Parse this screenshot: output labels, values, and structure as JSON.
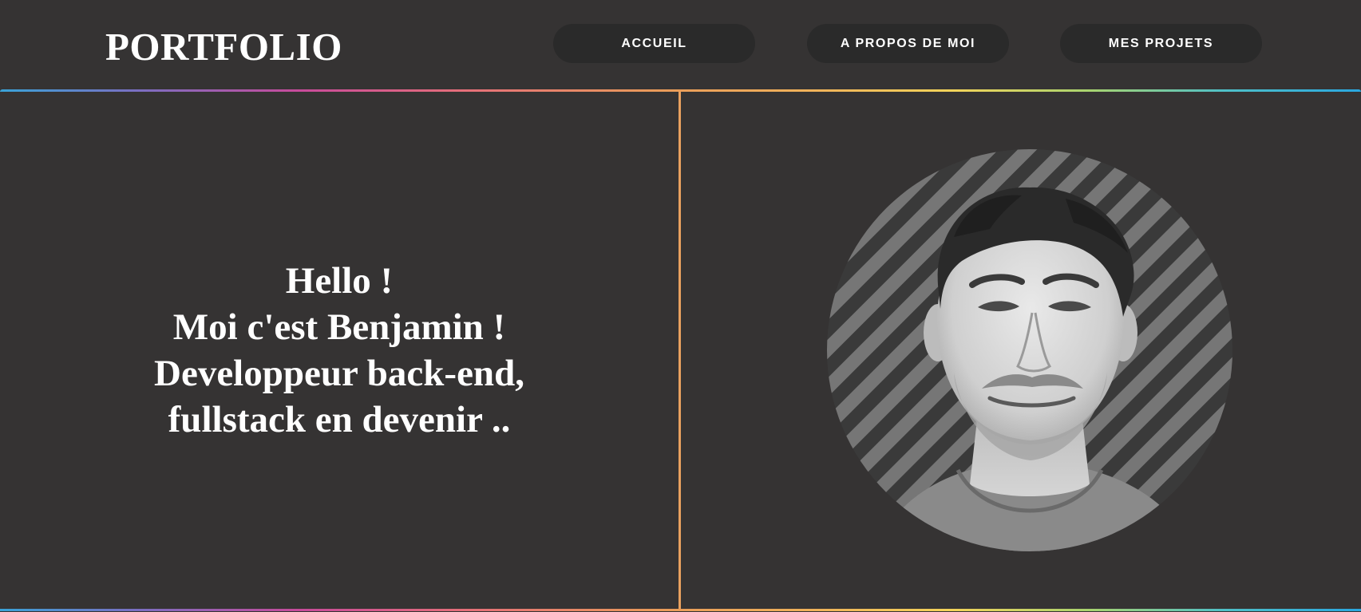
{
  "header": {
    "brand": "PORTFOLIO",
    "nav": [
      {
        "label": "ACCUEIL"
      },
      {
        "label": "A PROPOS DE MOI"
      },
      {
        "label": "MES PROJETS"
      }
    ]
  },
  "intro": {
    "lines": [
      "Hello !",
      "Moi c'est Benjamin !",
      "Developpeur back-end,",
      "fullstack en devenir .."
    ]
  },
  "colors": {
    "background": "#353333",
    "nav_button_bg": "#2a2a2a",
    "divider": "#e9a15f",
    "text": "#ffffff"
  },
  "photo": {
    "icon": "profile-photo"
  }
}
